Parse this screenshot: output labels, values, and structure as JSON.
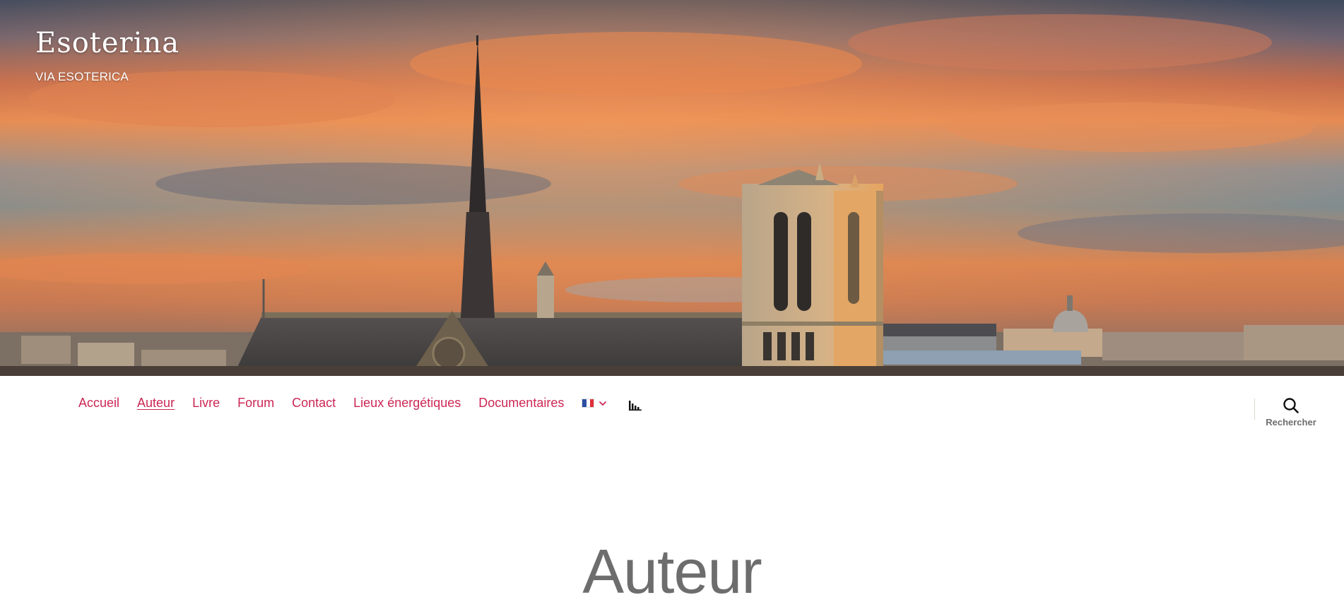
{
  "site": {
    "title": "Esoterina",
    "tagline": "VIA ESOTERICA"
  },
  "nav": {
    "items": [
      {
        "label": "Accueil",
        "current": false
      },
      {
        "label": "Auteur",
        "current": true
      },
      {
        "label": "Livre",
        "current": false
      },
      {
        "label": "Forum",
        "current": false
      },
      {
        "label": "Contact",
        "current": false
      },
      {
        "label": "Lieux énergétiques",
        "current": false
      },
      {
        "label": "Documentaires",
        "current": false
      }
    ],
    "language_icon": "french-flag-icon",
    "stats_icon": "bar-chart-icon"
  },
  "search": {
    "label": "Rechercher",
    "icon": "search-icon"
  },
  "page": {
    "title": "Auteur"
  },
  "colors": {
    "accent": "#cd2653",
    "muted_text": "#6d6d6d"
  }
}
